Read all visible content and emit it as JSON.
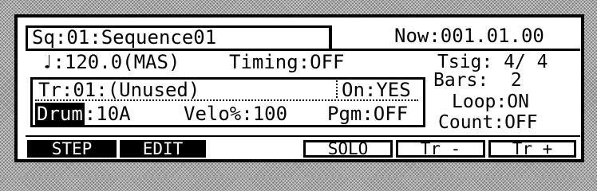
{
  "sequence": {
    "label": "Sq:01:Sequence01"
  },
  "position": {
    "label": "Now:001.01.00"
  },
  "tempo": {
    "label": "♩:120.0(MAS)"
  },
  "timing": {
    "label": "Timing:OFF"
  },
  "time_signature": {
    "label": "Tsig: 4/ 4"
  },
  "bars": {
    "label": "Bars:  2"
  },
  "loop": {
    "label": "Loop:ON"
  },
  "count": {
    "label": "Count:OFF"
  },
  "track": {
    "name_label": "Tr:01:(Unused)",
    "on_label": "On:YES",
    "type_value": "Drum",
    "type_suffix": ":10A",
    "velocity_label": "Velo%:100",
    "program_label": "Pgm:OFF"
  },
  "function_keys": [
    {
      "label": "STEP",
      "style": "filled"
    },
    {
      "label": "EDIT",
      "style": "filled"
    },
    {
      "label": "",
      "style": "blank"
    },
    {
      "label": "SOLO",
      "style": "outlined"
    },
    {
      "label": "Tr -",
      "style": "outlined"
    },
    {
      "label": "Tr +",
      "style": "outlined"
    }
  ]
}
